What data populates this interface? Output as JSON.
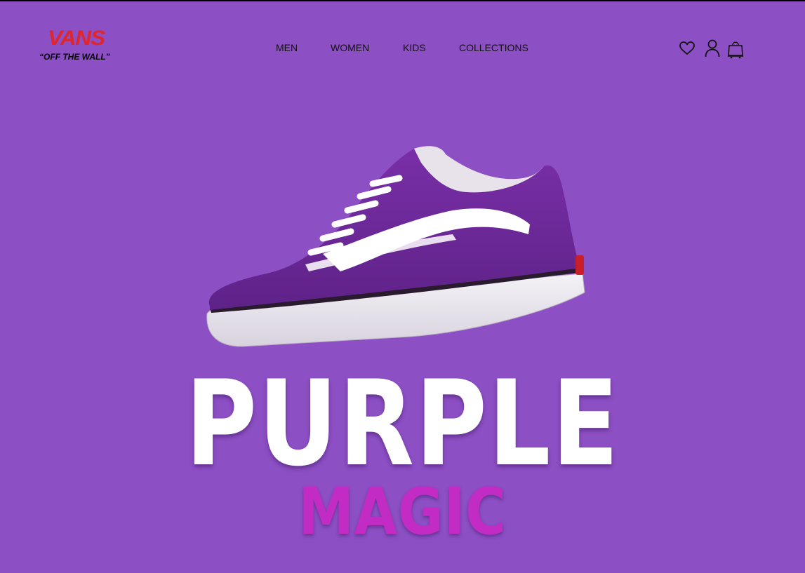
{
  "brand": {
    "logo_text": "VANS",
    "tagline": "“OFF THE WALL”",
    "logo_color": "#e0252b"
  },
  "nav": {
    "items": [
      {
        "label": "MEN"
      },
      {
        "label": "WOMEN"
      },
      {
        "label": "KIDS"
      },
      {
        "label": "COLLECTIONS"
      }
    ]
  },
  "header_icons": [
    "heart-icon",
    "user-icon",
    "shopping-bag-icon"
  ],
  "hero": {
    "title": "PURPLE",
    "subtitle": "MAGIC",
    "image": "purple-old-skool-sneaker"
  },
  "colors": {
    "background": "#8c4fc4",
    "title": "#ffffff",
    "subtitle": "#c22bc4",
    "shoe_body": "#6e2a9a",
    "stripe": "#ffffff"
  }
}
